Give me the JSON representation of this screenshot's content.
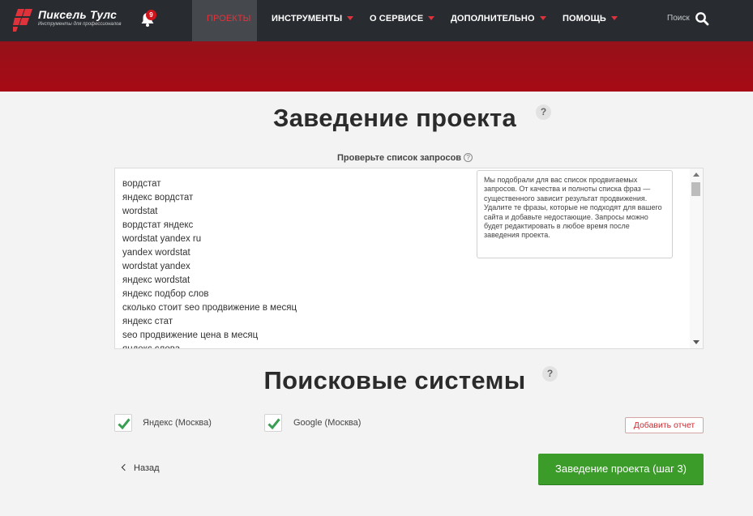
{
  "header": {
    "logo_title": "Пиксель Тулс",
    "logo_subtitle": "Инструменты для профессионалов",
    "notification_count": "9",
    "nav": [
      {
        "label": "ПРОЕКТЫ",
        "active": true
      },
      {
        "label": "ИНСТРУМЕНТЫ"
      },
      {
        "label": "О СЕРВИСЕ"
      },
      {
        "label": "ДОПОЛНИТЕЛЬНО"
      },
      {
        "label": "ПОМОЩЬ"
      }
    ],
    "search_label": "Поиск"
  },
  "page": {
    "title": "Заведение проекта",
    "help": "?",
    "queries_label": "Проверьте список запросов",
    "queries": [
      "вордстат",
      "яндекс вордстат",
      "wordstat",
      "вордстат яндекс",
      "wordstat yandex ru",
      "yandex wordstat",
      "wordstat yandex",
      "яндекс wordstat",
      "яндекс подбор слов",
      "сколько стоит seo продвижение в месяц",
      "яндекс стат",
      "seo продвижение цена в месяц",
      "яндекс слова"
    ],
    "tooltip": "Мы подобрали для вас список продвигаемых запросов. От качества и полноты списка фраз — существенного зависит результат продвижения. Удалите те фразы, которые не подходят для вашего сайта и добавьте недостающие. Запросы можно будет редактировать в любое время после заведения проекта."
  },
  "engines": {
    "title": "Поисковые системы",
    "items": [
      {
        "label": "Яндекс (Москва)",
        "checked": true
      },
      {
        "label": "Google (Москва)",
        "checked": true
      }
    ],
    "add_report": "Добавить отчет"
  },
  "footer": {
    "back": "Назад",
    "next": "Заведение проекта (шаг 3)"
  },
  "colors": {
    "topbar": "#282c31",
    "banner": "#a00b15",
    "accent_red": "#e0323a",
    "next_green": "#3b9c2a",
    "check_green": "#3a9e55"
  }
}
